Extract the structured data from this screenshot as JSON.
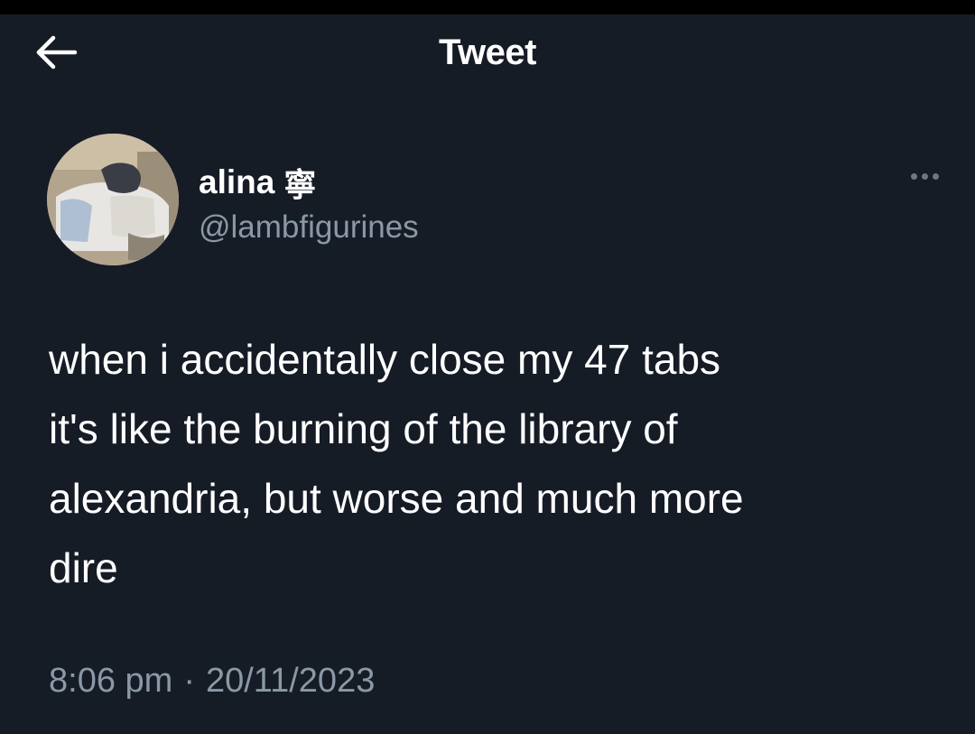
{
  "header": {
    "title": "Tweet",
    "back_icon": "arrow-left-icon"
  },
  "author": {
    "display_name": "alina",
    "name_glyph": "寧",
    "handle": "@lambfigurines",
    "avatar_icon": "avatar-photo"
  },
  "more_icon": "more-horizontal-icon",
  "tweet": {
    "text": "when i accidentally close my 47 tabs\nit's like the burning of the library of\nalexandria, but worse and much more\ndire"
  },
  "meta": {
    "time": "8:06 pm",
    "separator": "·",
    "date": "20/11/2023"
  },
  "colors": {
    "background": "#161c26",
    "text_primary": "#ffffff",
    "text_secondary": "#8b98a5"
  }
}
